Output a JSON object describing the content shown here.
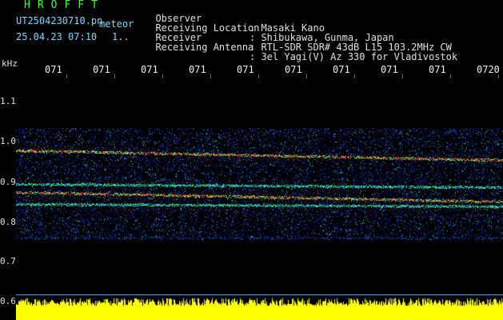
{
  "header": {
    "brand": "HROFFT",
    "filename": "UT2504230710.pn",
    "type": "meteor",
    "datetime": "25.04.23 07:10",
    "count": "1.."
  },
  "info": [
    {
      "label": "Observer",
      "value": ": Masaki Kano"
    },
    {
      "label": "Receiving Location",
      "value": ": Shibukawa, Gunma, Japan"
    },
    {
      "label": "Receiver",
      "value": ": RTL-SDR SDR# 43dB L15 103.2MHz CW"
    },
    {
      "label": "Receiving Antenna",
      "value": ": 3el Yagi(V) Az 330 for Vladivostok"
    }
  ],
  "yaxis": {
    "unit": "kHz",
    "ticks": [
      "1.1",
      "1.0",
      "0.9",
      "0.8",
      "0.7",
      "0.6"
    ]
  },
  "time_labels": [
    "071",
    "071",
    "071",
    "071",
    "071",
    "071",
    "071",
    "071",
    "071",
    "0720"
  ],
  "colors": {
    "brand": "#3cff3c",
    "band": "#ff3030",
    "trace": "#3aa0ff",
    "level": "#ffff00"
  }
}
